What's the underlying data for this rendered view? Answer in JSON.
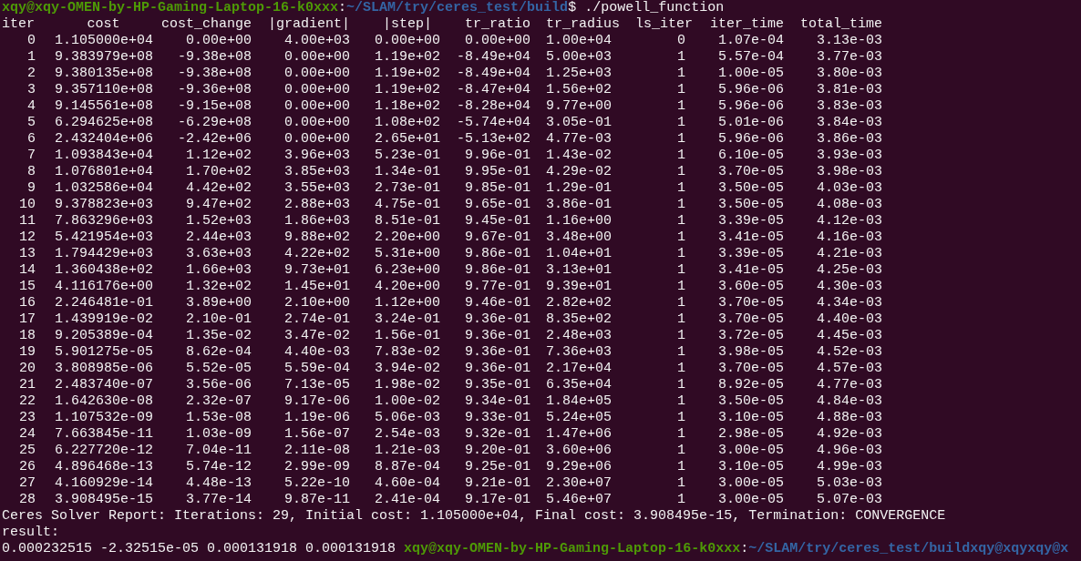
{
  "prompt": {
    "user_host": "xqy@xqy-OMEN-by-HP-Gaming-Laptop-16-k0xxx",
    "separator": ":",
    "path": "~/SLAM/try/ceres_test/build",
    "symbol": "$",
    "command": "./powell_function"
  },
  "table": {
    "columns": [
      "iter",
      "cost",
      "cost_change",
      "|gradient|",
      "|step|",
      "tr_ratio",
      "tr_radius",
      "ls_iter",
      "iter_time",
      "total_time"
    ],
    "rows": [
      [
        "0",
        "1.105000e+04",
        "0.00e+00",
        "4.00e+03",
        "0.00e+00",
        "0.00e+00",
        "1.00e+04",
        "0",
        "1.07e-04",
        "3.13e-03"
      ],
      [
        "1",
        "9.383979e+08",
        "-9.38e+08",
        "0.00e+00",
        "1.19e+02",
        "-8.49e+04",
        "5.00e+03",
        "1",
        "5.57e-04",
        "3.77e-03"
      ],
      [
        "2",
        "9.380135e+08",
        "-9.38e+08",
        "0.00e+00",
        "1.19e+02",
        "-8.49e+04",
        "1.25e+03",
        "1",
        "1.00e-05",
        "3.80e-03"
      ],
      [
        "3",
        "9.357110e+08",
        "-9.36e+08",
        "0.00e+00",
        "1.19e+02",
        "-8.47e+04",
        "1.56e+02",
        "1",
        "5.96e-06",
        "3.81e-03"
      ],
      [
        "4",
        "9.145561e+08",
        "-9.15e+08",
        "0.00e+00",
        "1.18e+02",
        "-8.28e+04",
        "9.77e+00",
        "1",
        "5.96e-06",
        "3.83e-03"
      ],
      [
        "5",
        "6.294625e+08",
        "-6.29e+08",
        "0.00e+00",
        "1.08e+02",
        "-5.74e+04",
        "3.05e-01",
        "1",
        "5.01e-06",
        "3.84e-03"
      ],
      [
        "6",
        "2.432404e+06",
        "-2.42e+06",
        "0.00e+00",
        "2.65e+01",
        "-5.13e+02",
        "4.77e-03",
        "1",
        "5.96e-06",
        "3.86e-03"
      ],
      [
        "7",
        "1.093843e+04",
        "1.12e+02",
        "3.96e+03",
        "5.23e-01",
        "9.96e-01",
        "1.43e-02",
        "1",
        "6.10e-05",
        "3.93e-03"
      ],
      [
        "8",
        "1.076801e+04",
        "1.70e+02",
        "3.85e+03",
        "1.34e-01",
        "9.95e-01",
        "4.29e-02",
        "1",
        "3.70e-05",
        "3.98e-03"
      ],
      [
        "9",
        "1.032586e+04",
        "4.42e+02",
        "3.55e+03",
        "2.73e-01",
        "9.85e-01",
        "1.29e-01",
        "1",
        "3.50e-05",
        "4.03e-03"
      ],
      [
        "10",
        "9.378823e+03",
        "9.47e+02",
        "2.88e+03",
        "4.75e-01",
        "9.65e-01",
        "3.86e-01",
        "1",
        "3.50e-05",
        "4.08e-03"
      ],
      [
        "11",
        "7.863296e+03",
        "1.52e+03",
        "1.86e+03",
        "8.51e-01",
        "9.45e-01",
        "1.16e+00",
        "1",
        "3.39e-05",
        "4.12e-03"
      ],
      [
        "12",
        "5.421954e+03",
        "2.44e+03",
        "9.88e+02",
        "2.20e+00",
        "9.67e-01",
        "3.48e+00",
        "1",
        "3.41e-05",
        "4.16e-03"
      ],
      [
        "13",
        "1.794429e+03",
        "3.63e+03",
        "4.22e+02",
        "5.31e+00",
        "9.86e-01",
        "1.04e+01",
        "1",
        "3.39e-05",
        "4.21e-03"
      ],
      [
        "14",
        "1.360438e+02",
        "1.66e+03",
        "9.73e+01",
        "6.23e+00",
        "9.86e-01",
        "3.13e+01",
        "1",
        "3.41e-05",
        "4.25e-03"
      ],
      [
        "15",
        "4.116176e+00",
        "1.32e+02",
        "1.45e+01",
        "4.20e+00",
        "9.77e-01",
        "9.39e+01",
        "1",
        "3.60e-05",
        "4.30e-03"
      ],
      [
        "16",
        "2.246481e-01",
        "3.89e+00",
        "2.10e+00",
        "1.12e+00",
        "9.46e-01",
        "2.82e+02",
        "1",
        "3.70e-05",
        "4.34e-03"
      ],
      [
        "17",
        "1.439919e-02",
        "2.10e-01",
        "2.74e-01",
        "3.24e-01",
        "9.36e-01",
        "8.35e+02",
        "1",
        "3.70e-05",
        "4.40e-03"
      ],
      [
        "18",
        "9.205389e-04",
        "1.35e-02",
        "3.47e-02",
        "1.56e-01",
        "9.36e-01",
        "2.48e+03",
        "1",
        "3.72e-05",
        "4.45e-03"
      ],
      [
        "19",
        "5.901275e-05",
        "8.62e-04",
        "4.40e-03",
        "7.83e-02",
        "9.36e-01",
        "7.36e+03",
        "1",
        "3.98e-05",
        "4.52e-03"
      ],
      [
        "20",
        "3.808985e-06",
        "5.52e-05",
        "5.59e-04",
        "3.94e-02",
        "9.36e-01",
        "2.17e+04",
        "1",
        "3.70e-05",
        "4.57e-03"
      ],
      [
        "21",
        "2.483740e-07",
        "3.56e-06",
        "7.13e-05",
        "1.98e-02",
        "9.35e-01",
        "6.35e+04",
        "1",
        "8.92e-05",
        "4.77e-03"
      ],
      [
        "22",
        "1.642630e-08",
        "2.32e-07",
        "9.17e-06",
        "1.00e-02",
        "9.34e-01",
        "1.84e+05",
        "1",
        "3.50e-05",
        "4.84e-03"
      ],
      [
        "23",
        "1.107532e-09",
        "1.53e-08",
        "1.19e-06",
        "5.06e-03",
        "9.33e-01",
        "5.24e+05",
        "1",
        "3.10e-05",
        "4.88e-03"
      ],
      [
        "24",
        "7.663845e-11",
        "1.03e-09",
        "1.56e-07",
        "2.54e-03",
        "9.32e-01",
        "1.47e+06",
        "1",
        "2.98e-05",
        "4.92e-03"
      ],
      [
        "25",
        "6.227720e-12",
        "7.04e-11",
        "2.11e-08",
        "1.21e-03",
        "9.20e-01",
        "3.60e+06",
        "1",
        "3.00e-05",
        "4.96e-03"
      ],
      [
        "26",
        "4.896468e-13",
        "5.74e-12",
        "2.99e-09",
        "8.87e-04",
        "9.25e-01",
        "9.29e+06",
        "1",
        "3.10e-05",
        "4.99e-03"
      ],
      [
        "27",
        "4.160929e-14",
        "4.48e-13",
        "5.22e-10",
        "4.60e-04",
        "9.21e-01",
        "2.30e+07",
        "1",
        "3.00e-05",
        "5.03e-03"
      ],
      [
        "28",
        "3.908495e-15",
        "3.77e-14",
        "9.87e-11",
        "2.41e-04",
        "9.17e-01",
        "5.46e+07",
        "1",
        "3.00e-05",
        "5.07e-03"
      ]
    ]
  },
  "report": "Ceres Solver Report: Iterations: 29, Initial cost: 1.105000e+04, Final cost: 3.908495e-15, Termination: CONVERGENCE",
  "result_label": "result:",
  "result_values": "0.000232515 -2.32515e-05 0.000131918 0.000131918",
  "next_prompt": {
    "user_host": "xqy@xqy-OMEN-by-HP-Gaming-Laptop-16-k0xxx",
    "separator": ":",
    "path": "~/SLAM/try/ceres_test/buildxqy@xqyxqy@x"
  }
}
